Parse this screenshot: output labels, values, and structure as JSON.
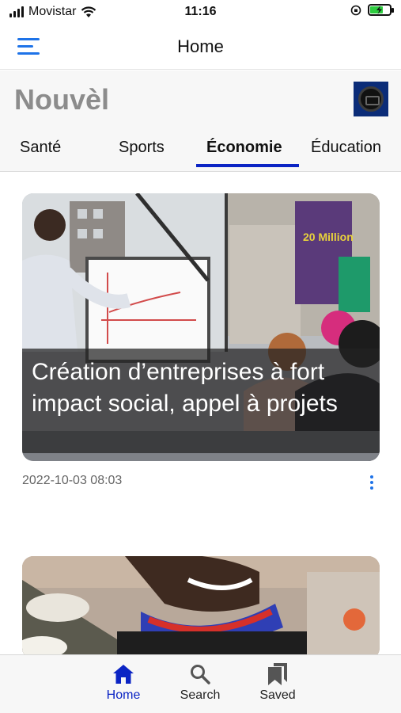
{
  "status_bar": {
    "carrier": "Movistar",
    "time": "11:16"
  },
  "nav": {
    "title": "Home"
  },
  "header": {
    "brand": "Nouvèl",
    "tabs": [
      {
        "label": "Santé",
        "active": false
      },
      {
        "label": "Sports",
        "active": false
      },
      {
        "label": "Économie",
        "active": true
      },
      {
        "label": "Éducation",
        "active": false
      }
    ]
  },
  "articles": [
    {
      "title": "Création d’entreprises à fort impact social, appel à projets",
      "timestamp": "2022-10-03 08:03",
      "image": "photo of a presenter at a whiteboard with an audience"
    },
    {
      "title": "",
      "timestamp": "",
      "image": "photo of a person smiling wearing a colored scarf"
    }
  ],
  "bottom_tabs": [
    {
      "label": "Home",
      "icon": "home-icon",
      "active": true
    },
    {
      "label": "Search",
      "icon": "search-icon",
      "active": false
    },
    {
      "label": "Saved",
      "icon": "saved-icon",
      "active": false
    }
  ],
  "colors": {
    "accent": "#0b24c4",
    "menu": "#1e73e8",
    "brand_text": "#8c8c8c"
  }
}
